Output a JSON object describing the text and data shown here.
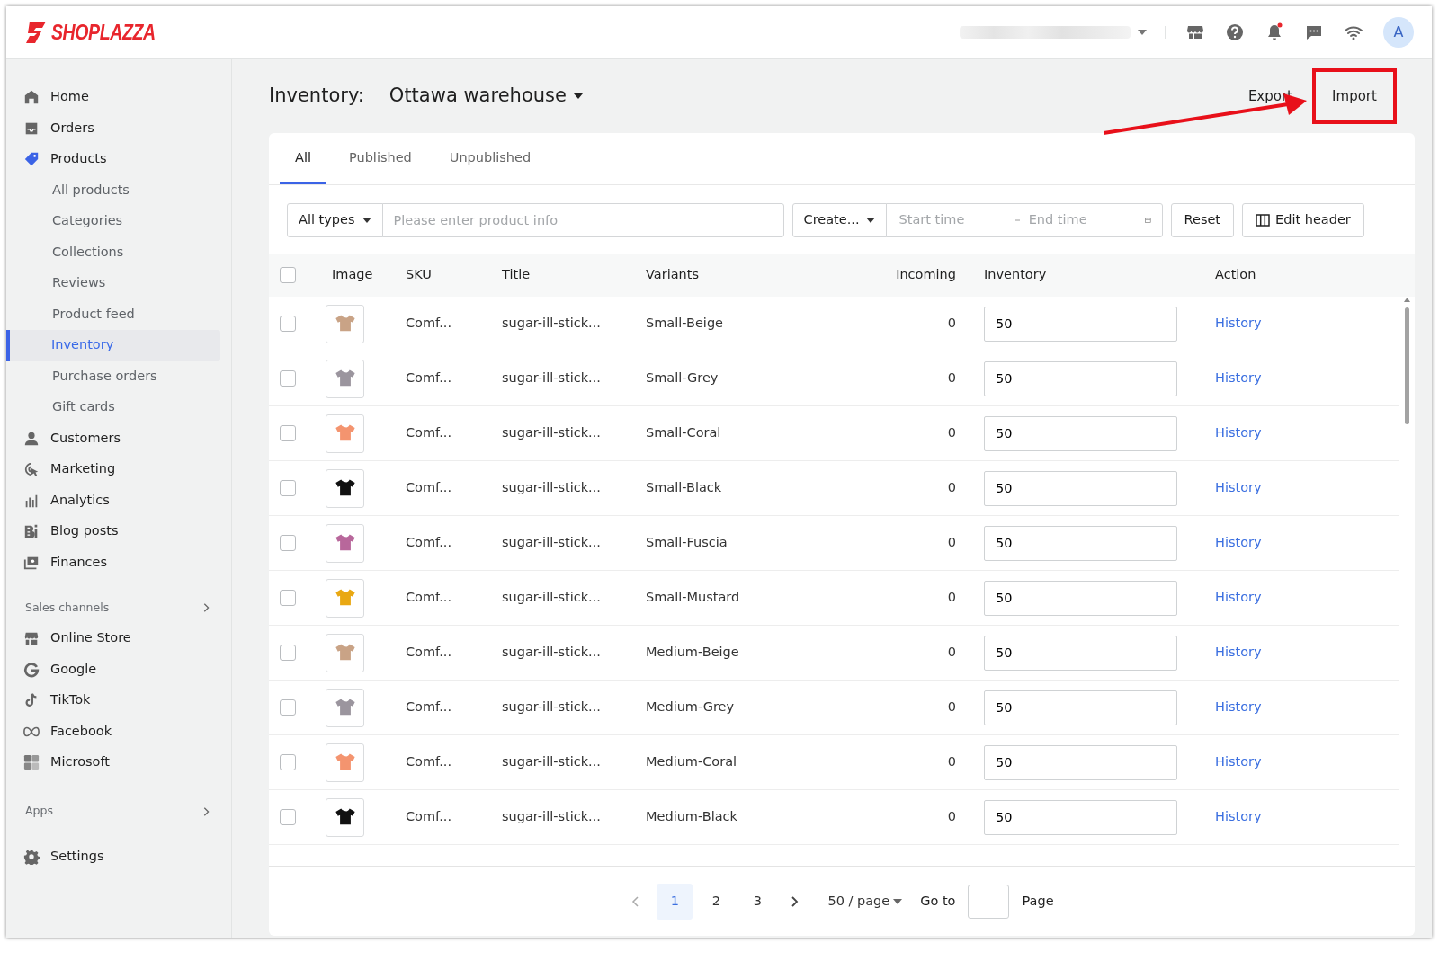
{
  "brand": "SHOPLAZZA",
  "topbar": {
    "avatar": "A",
    "has_notification": true
  },
  "sidebar": {
    "main": [
      {
        "label": "Home",
        "selected": false
      },
      {
        "label": "Orders",
        "selected": false
      },
      {
        "label": "Products",
        "selected": false,
        "children": [
          {
            "label": "All products",
            "selected": false
          },
          {
            "label": "Categories",
            "selected": false
          },
          {
            "label": "Collections",
            "selected": false
          },
          {
            "label": "Reviews",
            "selected": false
          },
          {
            "label": "Product feed",
            "selected": false
          },
          {
            "label": "Inventory",
            "selected": true
          },
          {
            "label": "Purchase orders",
            "selected": false
          },
          {
            "label": "Gift cards",
            "selected": false
          }
        ]
      },
      {
        "label": "Customers",
        "selected": false
      },
      {
        "label": "Marketing",
        "selected": false
      },
      {
        "label": "Analytics",
        "selected": false
      },
      {
        "label": "Blog posts",
        "selected": false
      },
      {
        "label": "Finances",
        "selected": false
      }
    ],
    "sales_channels": {
      "heading": "Sales channels",
      "items": [
        {
          "label": "Online Store",
          "selected": false
        },
        {
          "label": "Google",
          "selected": false
        },
        {
          "label": "TikTok",
          "selected": false
        },
        {
          "label": "Facebook",
          "selected": false
        },
        {
          "label": "Microsoft",
          "selected": false
        }
      ]
    },
    "apps": {
      "heading": "Apps"
    },
    "settings": {
      "label": "Settings",
      "selected": false
    }
  },
  "header": {
    "title": "Inventory:",
    "location": "Ottawa warehouse",
    "buttons": [
      {
        "label": "Export",
        "highlighted": false
      },
      {
        "label": "Import",
        "highlighted": true
      }
    ]
  },
  "tabs": [
    {
      "label": "All",
      "selected": true
    },
    {
      "label": "Published",
      "selected": false
    },
    {
      "label": "Unpublished",
      "selected": false
    }
  ],
  "filters": {
    "type": "All types",
    "search_placeholder": "Please enter product info",
    "created": "Create...",
    "start_placeholder": "Start time",
    "end_placeholder": "End time",
    "reset": "Reset",
    "edit_header": "Edit header"
  },
  "table": {
    "columns": [
      "Image",
      "SKU",
      "Title",
      "Variants",
      "Incoming",
      "Inventory",
      "Action"
    ],
    "all_checked": false,
    "rows": [
      {
        "checked": false,
        "color": "#c9a386",
        "sku": "Comf...",
        "title": "sugar-ill-stick...",
        "variant": "Small-Beige",
        "incoming": "0",
        "inventory": "50",
        "action": "History"
      },
      {
        "checked": false,
        "color": "#9b959e",
        "sku": "Comf...",
        "title": "sugar-ill-stick...",
        "variant": "Small-Grey",
        "incoming": "0",
        "inventory": "50",
        "action": "History"
      },
      {
        "checked": false,
        "color": "#f4946f",
        "sku": "Comf...",
        "title": "sugar-ill-stick...",
        "variant": "Small-Coral",
        "incoming": "0",
        "inventory": "50",
        "action": "History"
      },
      {
        "checked": false,
        "color": "#111111",
        "sku": "Comf...",
        "title": "sugar-ill-stick...",
        "variant": "Small-Black",
        "incoming": "0",
        "inventory": "50",
        "action": "History"
      },
      {
        "checked": false,
        "color": "#b8679b",
        "sku": "Comf...",
        "title": "sugar-ill-stick...",
        "variant": "Small-Fuscia",
        "incoming": "0",
        "inventory": "50",
        "action": "History"
      },
      {
        "checked": false,
        "color": "#e9a812",
        "sku": "Comf...",
        "title": "sugar-ill-stick...",
        "variant": "Small-Mustard",
        "incoming": "0",
        "inventory": "50",
        "action": "History"
      },
      {
        "checked": false,
        "color": "#c9a386",
        "sku": "Comf...",
        "title": "sugar-ill-stick...",
        "variant": "Medium-Beige",
        "incoming": "0",
        "inventory": "50",
        "action": "History"
      },
      {
        "checked": false,
        "color": "#9b959e",
        "sku": "Comf...",
        "title": "sugar-ill-stick...",
        "variant": "Medium-Grey",
        "incoming": "0",
        "inventory": "50",
        "action": "History"
      },
      {
        "checked": false,
        "color": "#f4946f",
        "sku": "Comf...",
        "title": "sugar-ill-stick...",
        "variant": "Medium-Coral",
        "incoming": "0",
        "inventory": "50",
        "action": "History"
      },
      {
        "checked": false,
        "color": "#111111",
        "sku": "Comf...",
        "title": "sugar-ill-stick...",
        "variant": "Medium-Black",
        "incoming": "0",
        "inventory": "50",
        "action": "History"
      }
    ]
  },
  "pagination": {
    "pages": [
      {
        "label": "1",
        "selected": true
      },
      {
        "label": "2",
        "selected": false
      },
      {
        "label": "3",
        "selected": false
      }
    ],
    "page_size": "50 / page",
    "goto_label": "Go to",
    "page_label": "Page"
  }
}
